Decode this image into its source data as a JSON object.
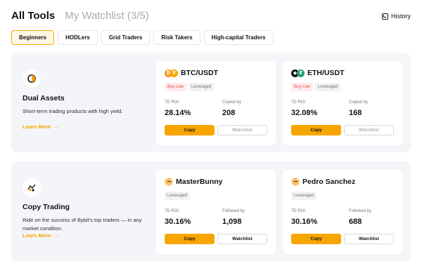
{
  "header": {
    "title": "All Tools",
    "watchlist": "My Watchlist (3/5)",
    "history": "History"
  },
  "tabs": [
    "Beginners",
    "HODLers",
    "Grid Traders",
    "Risk Takers",
    "High-capital Traders"
  ],
  "active_tab": "Beginners",
  "accent_color": "#f7a600",
  "sections": [
    {
      "icon": "dual-assets-icon",
      "name": "Dual Assets",
      "description": "Short-term trading products with high yield.",
      "link": "Learn More",
      "cards": [
        {
          "name": "BTC/USDT",
          "coins": [
            "BTC",
            "USDT"
          ],
          "tags": [
            "Buy Low",
            "Leveraged"
          ],
          "stat1_label": "7D ROI",
          "stat1_value": "28.14%",
          "stat2_label": "Copied by",
          "stat2_value": "208",
          "copy": "Copy",
          "watchlist": "Watchlist",
          "watchlist_disabled": true
        },
        {
          "name": "ETH/USDT",
          "coins": [
            "ETH",
            "USDT"
          ],
          "tags": [
            "Buy Low",
            "Leveraged"
          ],
          "stat1_label": "7D ROI",
          "stat1_value": "32.08%",
          "stat2_label": "Copied by",
          "stat2_value": "168",
          "copy": "Copy",
          "watchlist": "Watchlist",
          "watchlist_disabled": true
        }
      ]
    },
    {
      "icon": "copy-trading-icon",
      "name": "Copy Trading",
      "description": "Ride on the success of Bybit's top traders — in any market condition.",
      "link": "Learn More",
      "cards": [
        {
          "name": "MasterBunny",
          "tags": [
            "Leveraged"
          ],
          "stat1_label": "7D ROI",
          "stat1_value": "30.16%",
          "stat2_label": "Followed by",
          "stat2_value": "1,098",
          "copy": "Copy",
          "watchlist": "Watchlist",
          "watchlist_disabled": false
        },
        {
          "name": "Pedro Sanchez",
          "tags": [
            "Leveraged"
          ],
          "stat1_label": "7D ROI",
          "stat1_value": "30.16%",
          "stat2_label": "Followed by",
          "stat2_value": "688",
          "copy": "Copy",
          "watchlist": "Watchlist",
          "watchlist_disabled": false
        }
      ]
    }
  ]
}
